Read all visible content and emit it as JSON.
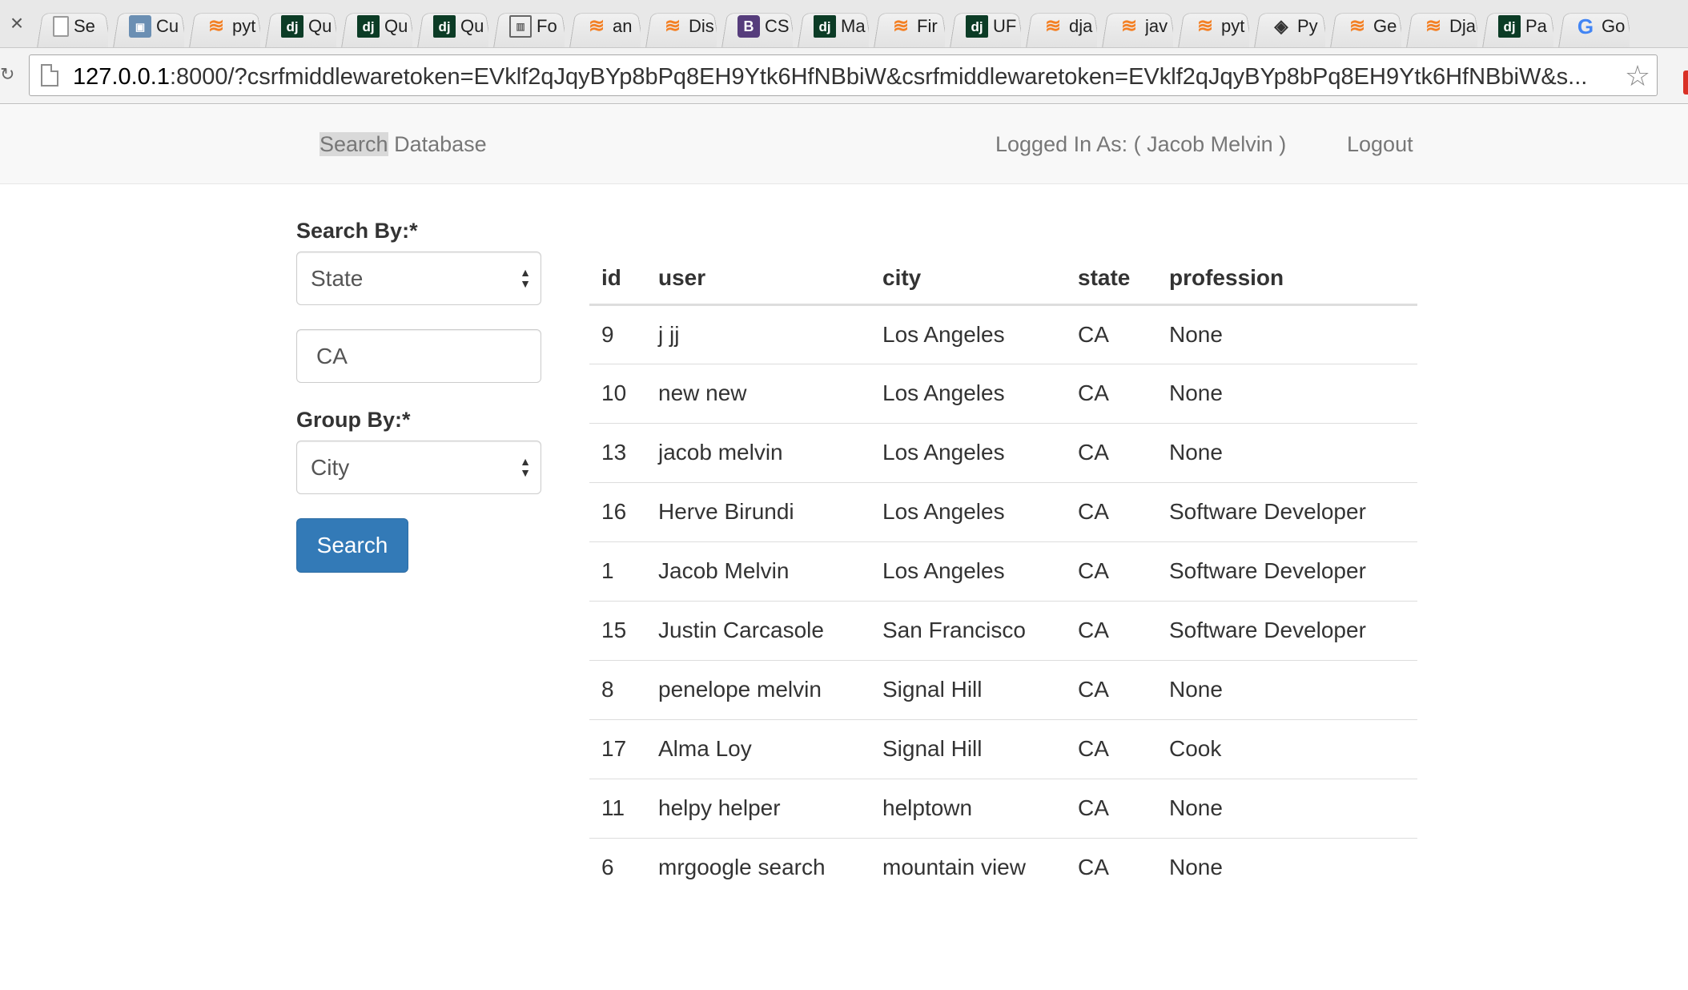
{
  "browser": {
    "tabs": [
      {
        "icon": "document-icon",
        "label": "Se"
      },
      {
        "icon": "cu-favicon-icon",
        "label": "Cu"
      },
      {
        "icon": "stackoverflow-icon",
        "label": "pyt"
      },
      {
        "icon": "django-icon",
        "label": "Qu"
      },
      {
        "icon": "django-icon",
        "label": "Qu"
      },
      {
        "icon": "django-icon",
        "label": "Qu"
      },
      {
        "icon": "fo-favicon-icon",
        "label": "Fo"
      },
      {
        "icon": "stackoverflow-icon",
        "label": "an"
      },
      {
        "icon": "stackoverflow-icon",
        "label": "Dis"
      },
      {
        "icon": "bootstrap-icon",
        "label": "CS"
      },
      {
        "icon": "django-icon",
        "label": "Ma"
      },
      {
        "icon": "stackoverflow-icon",
        "label": "Fir"
      },
      {
        "icon": "django-icon",
        "label": "UF"
      },
      {
        "icon": "stackoverflow-icon",
        "label": "dja"
      },
      {
        "icon": "stackoverflow-icon",
        "label": "jav"
      },
      {
        "icon": "stackoverflow-icon",
        "label": "pyt"
      },
      {
        "icon": "pycharm-icon",
        "label": "Py"
      },
      {
        "icon": "stackoverflow-icon",
        "label": "Ge"
      },
      {
        "icon": "stackoverflow-icon",
        "label": "Dja"
      },
      {
        "icon": "django-icon",
        "label": "Pa"
      },
      {
        "icon": "google-icon",
        "label": "Go"
      }
    ],
    "url_host": "127.0.0.1",
    "url_rest": ":8000/?csrfmiddlewaretoken=EVklf2qJqyBYp8bPq8EH9Ytk6HfNBbiW&csrfmiddlewaretoken=EVklf2qJqyBYp8bPq8EH9Ytk6HfNBbiW&s..."
  },
  "navbar": {
    "brand_highlight": "Search",
    "brand_rest": " Database",
    "logged_in": "Logged In As: ( Jacob Melvin )",
    "logout": "Logout"
  },
  "form": {
    "search_by_label": "Search By:*",
    "search_by_value": "State",
    "query_value": "CA",
    "group_by_label": "Group By:*",
    "group_by_value": "City",
    "search_button": "Search"
  },
  "table": {
    "headers": [
      "id",
      "user",
      "city",
      "state",
      "profession"
    ],
    "rows": [
      [
        "9",
        "j jj",
        "Los Angeles",
        "CA",
        "None"
      ],
      [
        "10",
        "new new",
        "Los Angeles",
        "CA",
        "None"
      ],
      [
        "13",
        "jacob melvin",
        "Los Angeles",
        "CA",
        "None"
      ],
      [
        "16",
        "Herve Birundi",
        "Los Angeles",
        "CA",
        "Software Developer"
      ],
      [
        "1",
        "Jacob Melvin",
        "Los Angeles",
        "CA",
        "Software Developer"
      ],
      [
        "15",
        "Justin Carcasole",
        "San Francisco",
        "CA",
        "Software Developer"
      ],
      [
        "8",
        "penelope melvin",
        "Signal Hill",
        "CA",
        "None"
      ],
      [
        "17",
        "Alma Loy",
        "Signal Hill",
        "CA",
        "Cook"
      ],
      [
        "11",
        "helpy helper",
        "helptown",
        "CA",
        "None"
      ],
      [
        "6",
        "mrgoogle search",
        "mountain view",
        "CA",
        "None"
      ]
    ]
  },
  "colors": {
    "primary_button": "#337ab7",
    "navbar_bg": "#f8f8f8",
    "navbar_text": "#777777"
  }
}
